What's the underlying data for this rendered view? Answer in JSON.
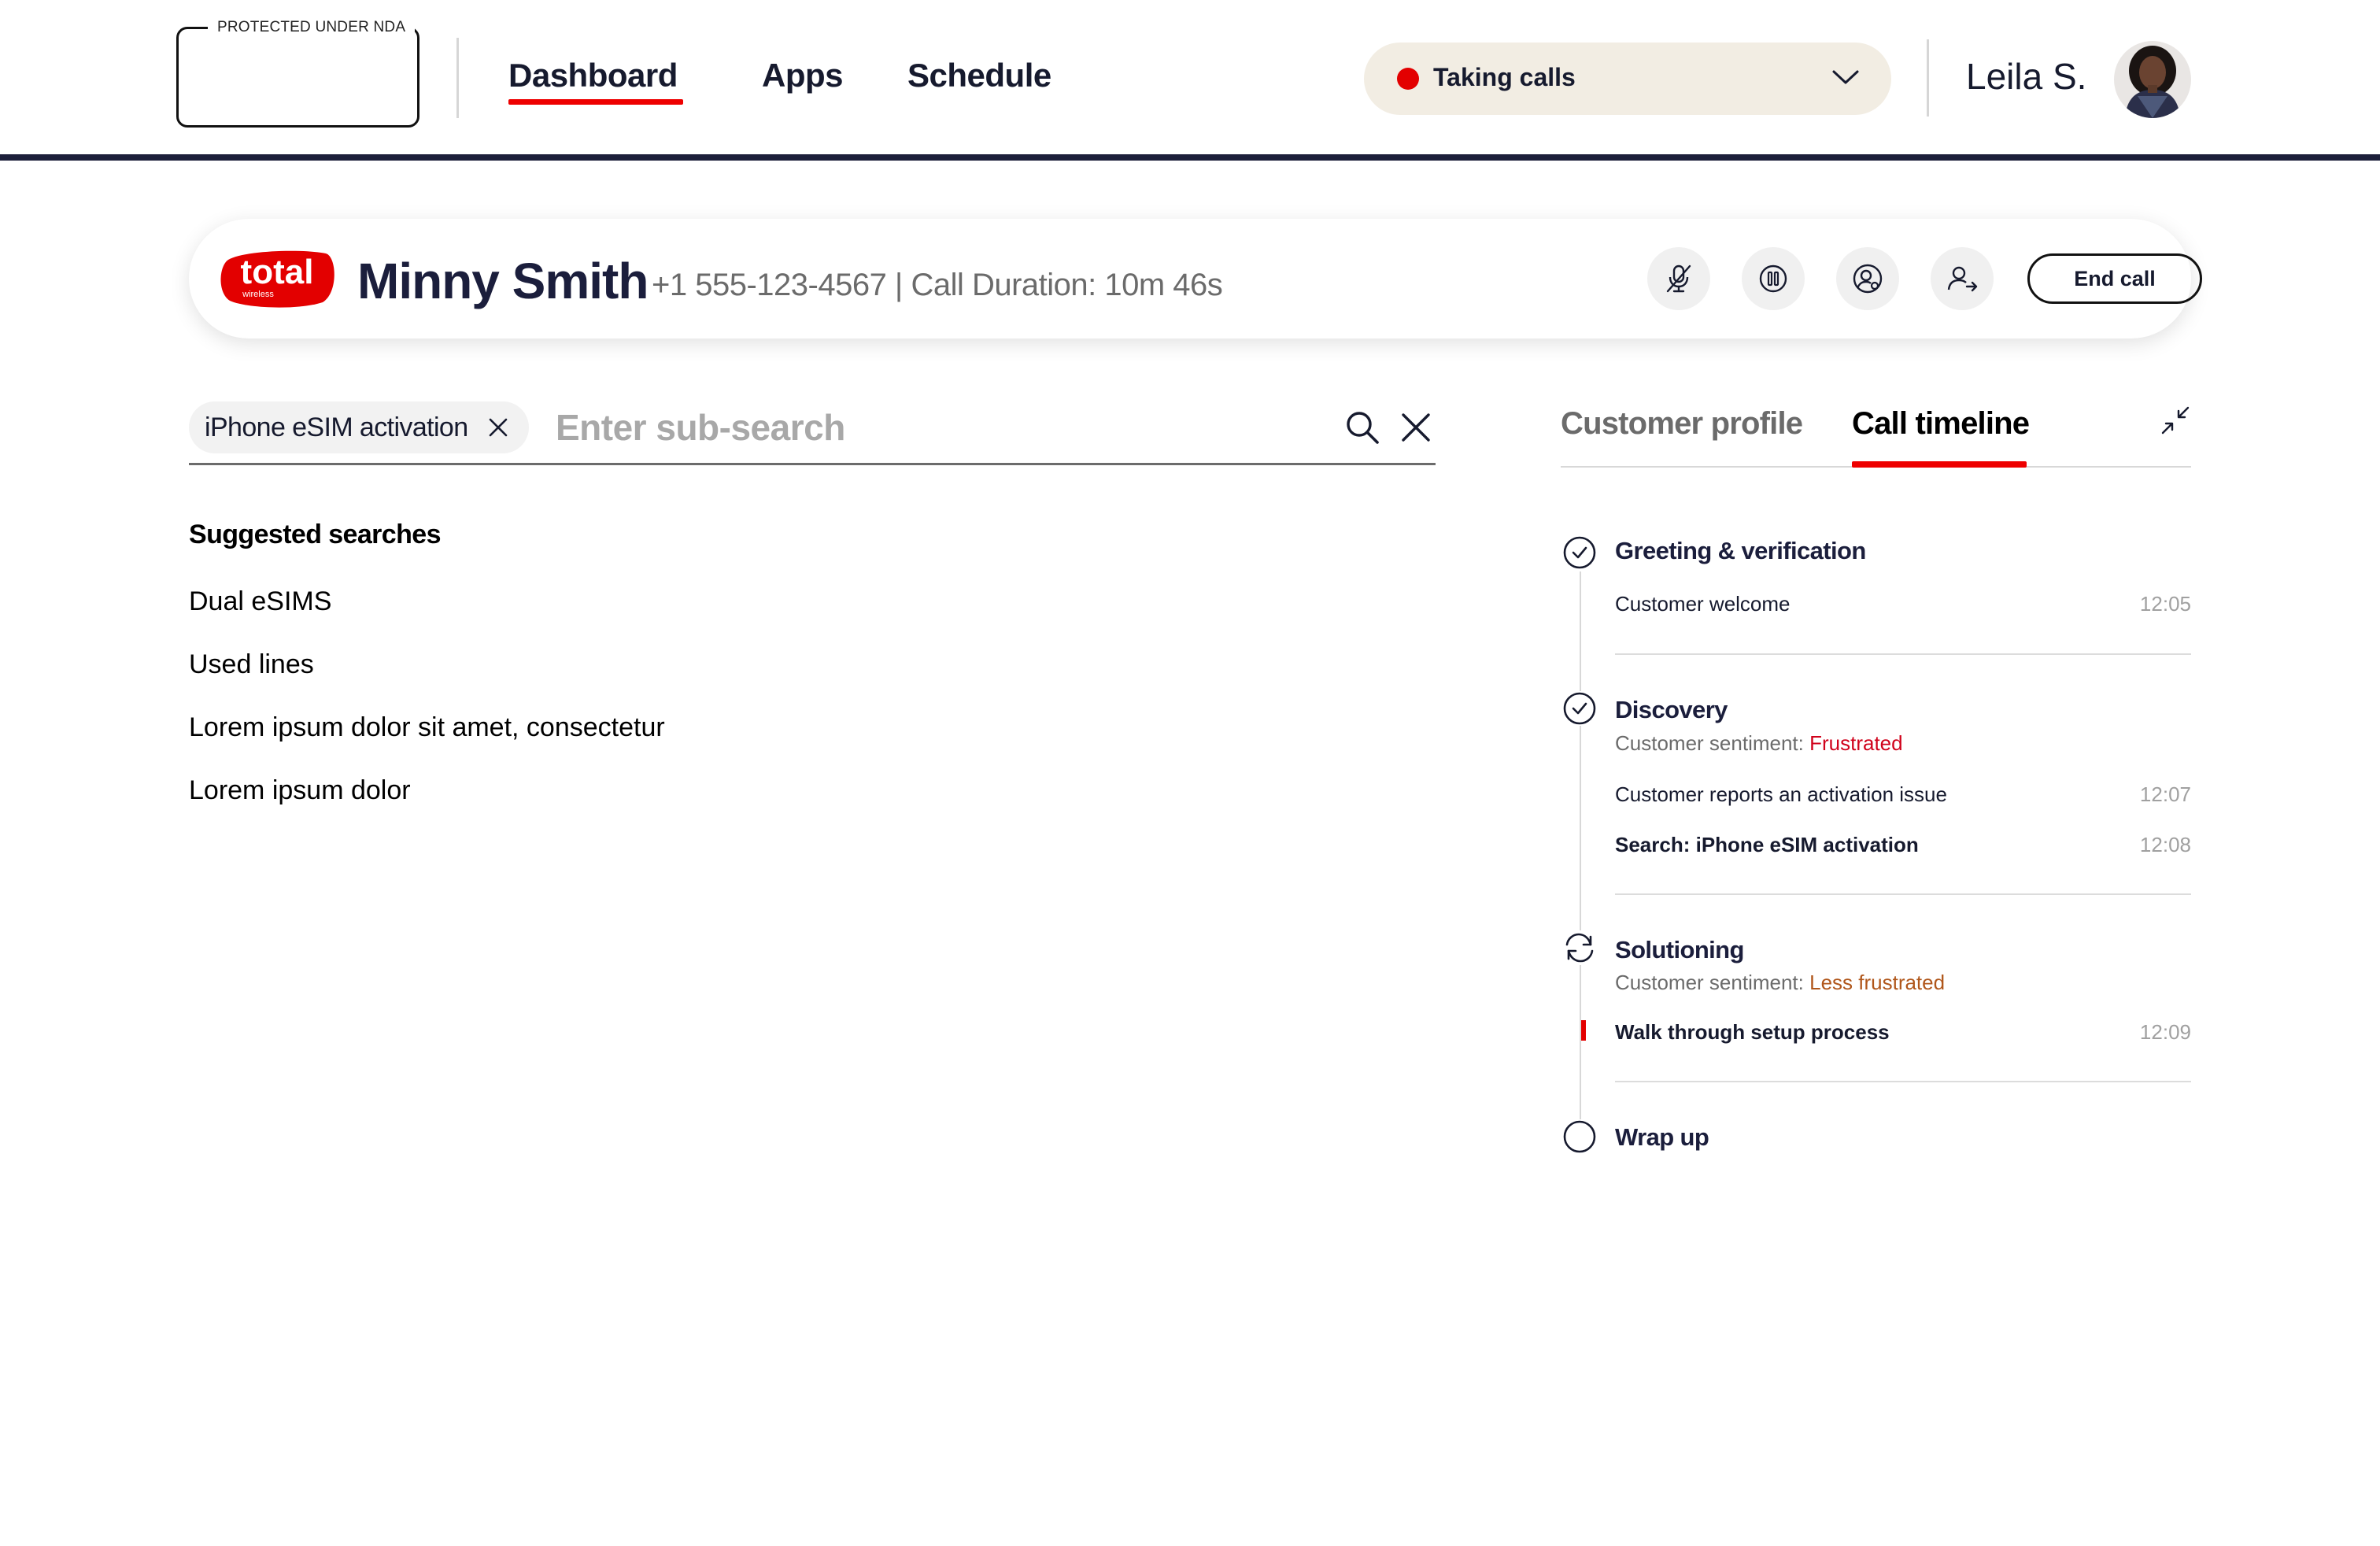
{
  "header": {
    "logo_label": "PROTECTED UNDER NDA",
    "nav": [
      {
        "label": "Dashboard"
      },
      {
        "label": "Apps"
      },
      {
        "label": "Schedule"
      }
    ],
    "status": {
      "label": "Taking calls",
      "color": "#e30000"
    },
    "user_name": "Leila S."
  },
  "call": {
    "brand_top": "total",
    "brand_bottom": "wireless",
    "customer_name": "Minny Smith",
    "phone_duration": "+1 555-123-4567 | Call Duration: 10m 46s",
    "controls": [
      "mic-off-icon",
      "pause-icon",
      "user-settings-icon",
      "transfer-user-icon"
    ],
    "end_call_label": "End call"
  },
  "search": {
    "chip_label": "iPhone eSIM activation",
    "sub_search_placeholder": "Enter sub-search",
    "suggested_title": "Suggested searches",
    "suggestions": [
      "Dual eSIMS",
      "Used lines",
      "Lorem ipsum dolor sit amet, consectetur",
      "Lorem ipsum dolor"
    ]
  },
  "panel": {
    "tabs": [
      {
        "label": "Customer profile",
        "active": false
      },
      {
        "label": "Call timeline",
        "active": true
      }
    ],
    "sentiment_label": "Customer sentiment:",
    "timeline": [
      {
        "title": "Greeting & verification",
        "status": "done",
        "events": [
          {
            "text": "Customer welcome",
            "time": "12:05"
          }
        ]
      },
      {
        "title": "Discovery",
        "status": "done",
        "sentiment": "Frustrated",
        "sentiment_color": "#d0021b",
        "events": [
          {
            "text": "Customer reports an activation issue",
            "time": "12:07"
          },
          {
            "text": "Search: iPhone eSIM activation",
            "time": "12:08"
          }
        ]
      },
      {
        "title": "Solutioning",
        "status": "in-progress",
        "sentiment": "Less frustrated",
        "sentiment_color": "#b0561a",
        "events": [
          {
            "text": "Walk through setup process",
            "time": "12:09"
          }
        ]
      },
      {
        "title": "Wrap up",
        "status": "pending",
        "events": []
      }
    ]
  },
  "colors": {
    "accent_red": "#ee0000",
    "navy": "#1c1f3a",
    "status_pill_bg": "#f2ede3"
  }
}
